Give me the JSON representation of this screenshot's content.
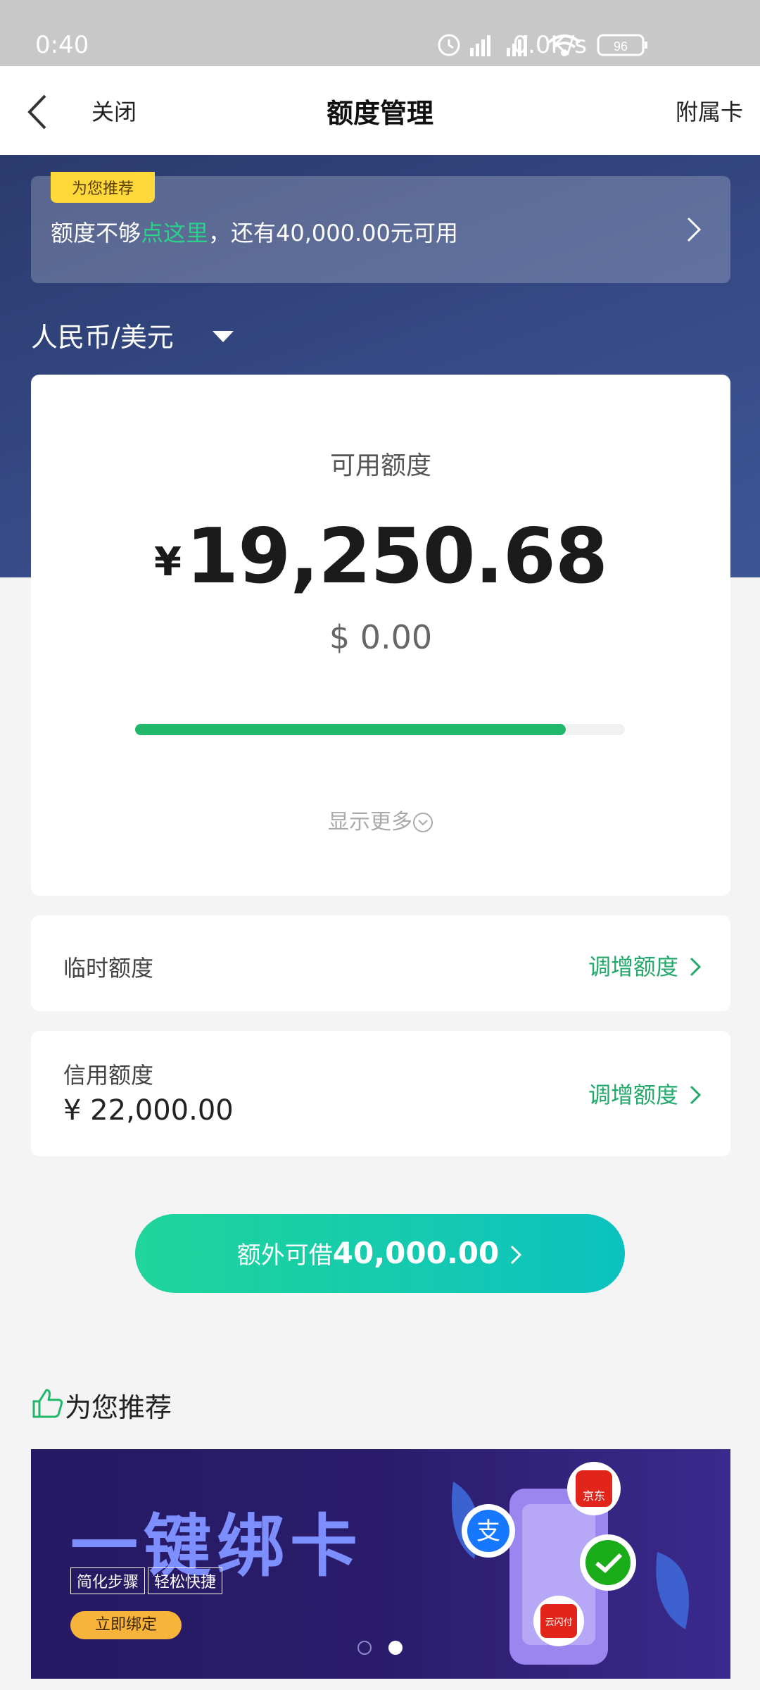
{
  "status_bar": {
    "time": "0:40",
    "network_speed": "0.0K/s",
    "battery": "96"
  },
  "nav": {
    "close_label": "关闭",
    "title": "额度管理",
    "right_label": "附属卡"
  },
  "promo": {
    "tag": "为您推荐",
    "text_prefix": "额度不够",
    "text_highlight": "点这里",
    "text_suffix": "，还有40,000.00元可用"
  },
  "currency": {
    "selected": "人民币/美元"
  },
  "available": {
    "label": "可用额度",
    "currency_symbol": "¥",
    "amount": "19,250.68",
    "usd_amount": "$ 0.00",
    "progress_fraction": 0.88,
    "show_more": "显示更多"
  },
  "temporary_limit": {
    "label": "临时额度",
    "action": "调增额度"
  },
  "credit_limit": {
    "label": "信用额度",
    "value": "¥ 22,000.00",
    "action": "调增额度"
  },
  "borrow_button": {
    "label": "额外可借",
    "amount": "40,000.00"
  },
  "recommend": {
    "title": "为您推荐",
    "banner": {
      "title": "一键绑卡",
      "tags": [
        "简化步骤",
        "轻松快捷"
      ],
      "cta": "立即绑定",
      "app_labels": [
        "支",
        "京东",
        "云闪付"
      ]
    },
    "carousel_active_index": 1
  },
  "colors": {
    "accent_green": "#22b86c",
    "hero_blue": "#364a86",
    "promo_tag_yellow": "#ffd83a"
  }
}
